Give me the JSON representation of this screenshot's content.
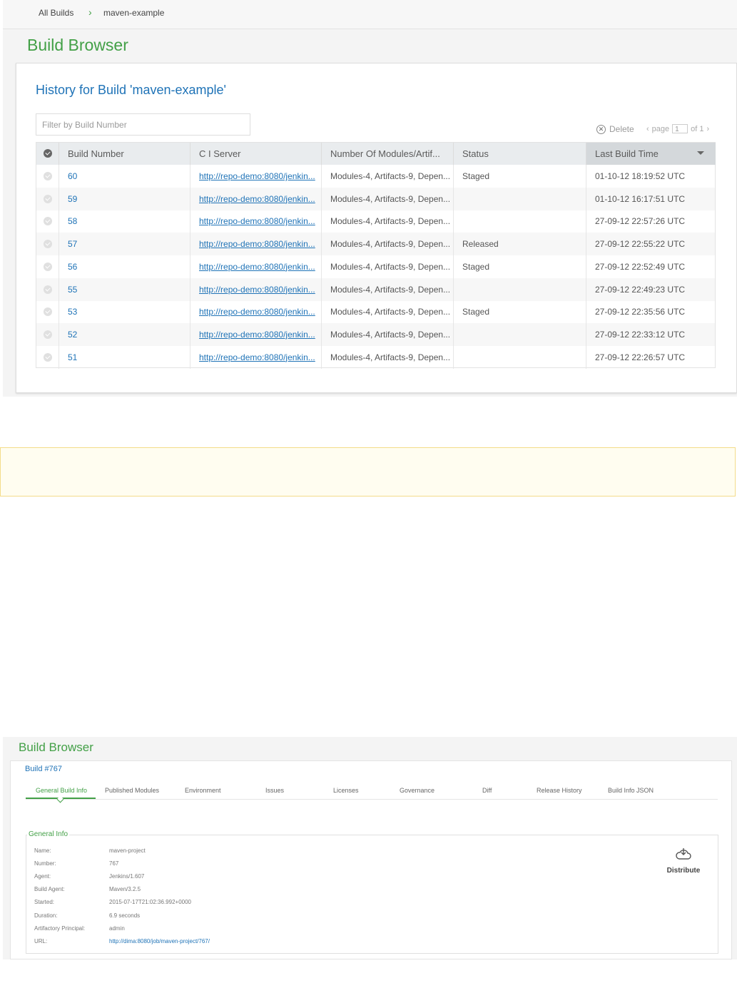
{
  "breadcrumb": {
    "all_builds": "All Builds",
    "separator": "›",
    "current": "maven-example"
  },
  "top": {
    "page_title": "Build Browser",
    "history_title": "History for Build 'maven-example'",
    "filter_placeholder": "Filter by Build Number",
    "delete_label": "Delete",
    "pager": {
      "prev": "‹",
      "page_label": "page",
      "page": "1",
      "of_label": "of 1",
      "next": "›"
    },
    "columns": [
      "Build Number",
      "C I Server",
      "Number Of Modules/Artif...",
      "Status",
      "Last Build Time"
    ],
    "rows": [
      {
        "number": "60",
        "ci": "http://repo-demo:8080/jenkin...",
        "modules": "Modules-4, Artifacts-9, Depen...",
        "status": "Staged",
        "time": "01-10-12 18:19:52 UTC"
      },
      {
        "number": "59",
        "ci": "http://repo-demo:8080/jenkin...",
        "modules": "Modules-4, Artifacts-9, Depen...",
        "status": "",
        "time": "01-10-12 16:17:51 UTC"
      },
      {
        "number": "58",
        "ci": "http://repo-demo:8080/jenkin...",
        "modules": "Modules-4, Artifacts-9, Depen...",
        "status": "",
        "time": "27-09-12 22:57:26 UTC"
      },
      {
        "number": "57",
        "ci": "http://repo-demo:8080/jenkin...",
        "modules": "Modules-4, Artifacts-9, Depen...",
        "status": "Released",
        "time": "27-09-12 22:55:22 UTC"
      },
      {
        "number": "56",
        "ci": "http://repo-demo:8080/jenkin...",
        "modules": "Modules-4, Artifacts-9, Depen...",
        "status": "Staged",
        "time": "27-09-12 22:52:49 UTC"
      },
      {
        "number": "55",
        "ci": "http://repo-demo:8080/jenkin...",
        "modules": "Modules-4, Artifacts-9, Depen...",
        "status": "",
        "time": "27-09-12 22:49:23 UTC"
      },
      {
        "number": "53",
        "ci": "http://repo-demo:8080/jenkin...",
        "modules": "Modules-4, Artifacts-9, Depen...",
        "status": "Staged",
        "time": "27-09-12 22:35:56 UTC"
      },
      {
        "number": "52",
        "ci": "http://repo-demo:8080/jenkin...",
        "modules": "Modules-4, Artifacts-9, Depen...",
        "status": "",
        "time": "27-09-12 22:33:12 UTC"
      },
      {
        "number": "51",
        "ci": "http://repo-demo:8080/jenkin...",
        "modules": "Modules-4, Artifacts-9, Depen...",
        "status": "",
        "time": "27-09-12 22:26:57 UTC"
      }
    ]
  },
  "bottom": {
    "page_title": "Build Browser",
    "build_title": "Build #767",
    "tabs": [
      "General Build Info",
      "Published Modules",
      "Environment",
      "Issues",
      "Licenses",
      "Governance",
      "Diff",
      "Release History",
      "Build Info JSON"
    ],
    "section_title": "General Info",
    "fields": [
      {
        "label": "Name:",
        "value": "maven-project"
      },
      {
        "label": "Number:",
        "value": "767"
      },
      {
        "label": "Agent:",
        "value": "Jenkins/1.607"
      },
      {
        "label": "Build Agent:",
        "value": "Maven/3.2.5"
      },
      {
        "label": "Started:",
        "value": "2015-07-17T21:02:36.992+0000"
      },
      {
        "label": "Duration:",
        "value": "6.9 seconds"
      },
      {
        "label": "Artifactory Principal:",
        "value": "admin"
      },
      {
        "label": "URL:",
        "value": "http://dima:8080/job/maven-project/767/"
      }
    ],
    "distribute_label": "Distribute"
  },
  "colors": {
    "accent_green": "#43a047",
    "link_blue": "#1f73b7",
    "notice_border": "#f4dc8a"
  }
}
